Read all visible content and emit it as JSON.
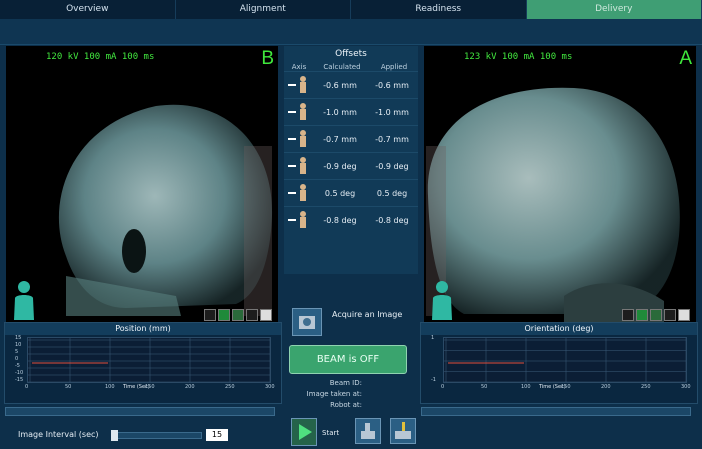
{
  "tabs": [
    {
      "label": "Overview"
    },
    {
      "label": "Alignment"
    },
    {
      "label": "Readiness"
    },
    {
      "label": "Delivery"
    }
  ],
  "left_image": {
    "settings": "120 kV 100 mA 100 ms",
    "letter": "B"
  },
  "right_image": {
    "settings": "123 kV 100 mA 100 ms",
    "letter": "A"
  },
  "offsets": {
    "title": "Offsets",
    "headers": {
      "axis": "Axis",
      "calculated": "Calculated",
      "applied": "Applied"
    },
    "rows": [
      {
        "icon": "translate-down-icon",
        "calculated": "-0.6 mm",
        "applied": "-0.6 mm"
      },
      {
        "icon": "translate-right-icon",
        "calculated": "-1.0 mm",
        "applied": "-1.0 mm"
      },
      {
        "icon": "translate-up-icon",
        "calculated": "-0.7 mm",
        "applied": "-0.7 mm"
      },
      {
        "icon": "rotate-pitch-icon",
        "calculated": "-0.9 deg",
        "applied": "-0.9 deg"
      },
      {
        "icon": "rotate-roll-icon",
        "calculated": "0.5 deg",
        "applied": "0.5 deg"
      },
      {
        "icon": "rotate-yaw-icon",
        "calculated": "-0.8 deg",
        "applied": "-0.8 deg"
      }
    ]
  },
  "acquire": {
    "label": "Acquire an Image"
  },
  "beam": {
    "label": "BEAM is OFF",
    "color": "#3aa46e"
  },
  "info": {
    "beam_id": "Beam ID:",
    "image_taken": "Image taken at:",
    "robot": "Robot at:"
  },
  "position_plot": {
    "title": "Position (mm)",
    "ylabel": "Position (mm)",
    "xlabel": "Time (Sec)",
    "yticks": [
      "15",
      "10",
      "5",
      "0",
      "-5",
      "-10",
      "-15"
    ],
    "xticks": [
      "0",
      "50",
      "100",
      "150",
      "200",
      "250",
      "300"
    ]
  },
  "orientation_plot": {
    "title": "Orientation (deg)",
    "ylabel": "Orientation (deg)",
    "xlabel": "Time (Sec)",
    "yticks": [
      "1",
      "",
      "",
      "",
      "-1"
    ],
    "xticks": [
      "0",
      "50",
      "100",
      "150",
      "200",
      "250",
      "300"
    ]
  },
  "controls": {
    "interval_label": "Image Interval (sec)",
    "interval_value": "15",
    "start_label": "Start"
  },
  "colors": {
    "accent": "#3f9e74",
    "kv_text": "#42e83f"
  }
}
